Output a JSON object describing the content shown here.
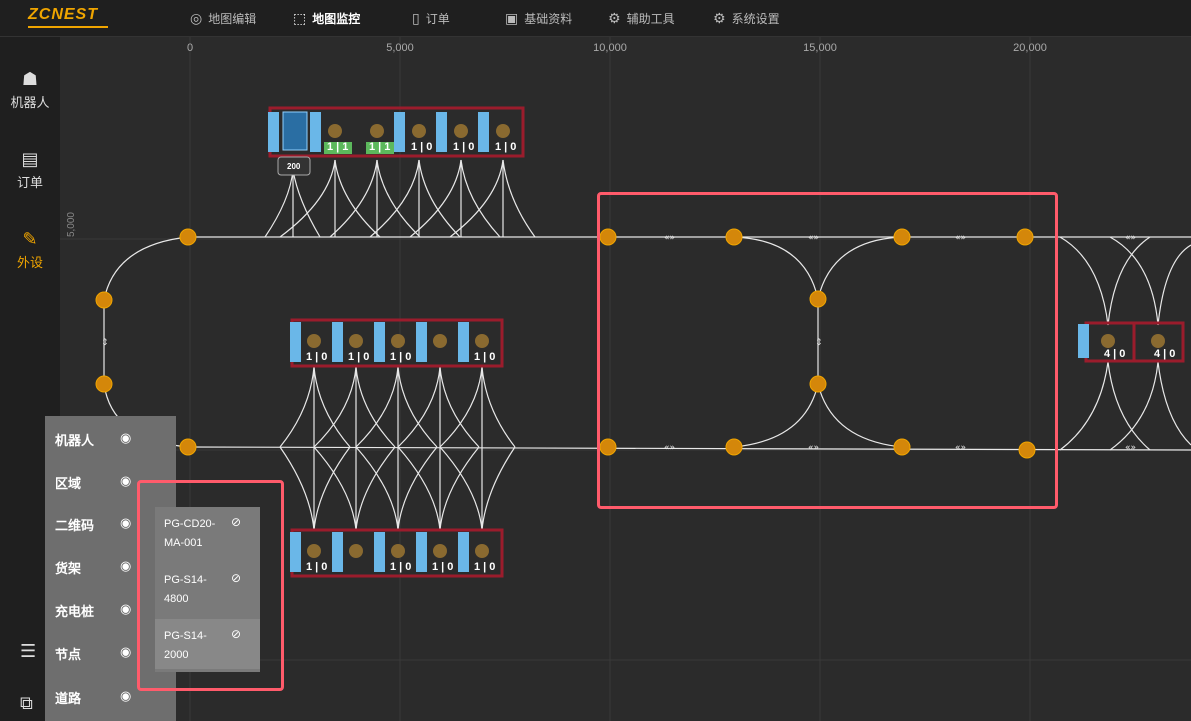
{
  "app": {
    "logo": "ZCNEST"
  },
  "nav": [
    {
      "label": "地图编辑",
      "icon": "location-pin-icon",
      "glyph": "◎",
      "active": false
    },
    {
      "label": "地图监控",
      "icon": "monitor-chart-icon",
      "glyph": "⬚",
      "active": true
    },
    {
      "label": "订单",
      "icon": "order-document-icon",
      "glyph": "▯",
      "active": false
    },
    {
      "label": "基础资料",
      "icon": "basic-data-icon",
      "glyph": "▣",
      "active": false
    },
    {
      "label": "辅助工具",
      "icon": "gear-icon",
      "glyph": "⚙",
      "active": false
    },
    {
      "label": "系统设置",
      "icon": "settings-icon",
      "glyph": "⚙",
      "active": false
    }
  ],
  "sidebar": [
    {
      "label": "机器人",
      "icon": "robot-icon",
      "glyph": "☗",
      "active": false
    },
    {
      "label": "订单",
      "icon": "document-icon",
      "glyph": "▤",
      "active": false
    },
    {
      "label": "外设",
      "icon": "wrench-icon",
      "glyph": "✎",
      "active": true
    }
  ],
  "ruler": {
    "x_ticks": [
      "0",
      "5,000",
      "10,000",
      "15,000",
      "20,000"
    ],
    "y_tick": "5,000"
  },
  "layers": [
    {
      "label": "机器人"
    },
    {
      "label": "区域"
    },
    {
      "label": "二维码"
    },
    {
      "label": "货架"
    },
    {
      "label": "充电桩"
    },
    {
      "label": "节点"
    },
    {
      "label": "道路"
    }
  ],
  "qr_list": [
    {
      "label": "PG-CD20-\nMA-001",
      "line1": "PG-CD20-",
      "line2": "MA-001"
    },
    {
      "label": "PG-S14-\n4800",
      "line1": "PG-S14-",
      "line2": "4800"
    },
    {
      "label": "PG-S14-\n2000",
      "line1": "PG-S14-",
      "line2": "2000"
    }
  ],
  "shelves": {
    "top_counts": [
      "1 | 1",
      "1 | 1",
      "1 | 0",
      "1 | 0",
      "1 | 0"
    ],
    "mid_counts": [
      "1 | 0",
      "1 | 0",
      "1 | 0",
      "1 | 0"
    ],
    "bottom_counts": [
      "1 | 0",
      "1 | 0",
      "1 | 0",
      "1 | 0"
    ],
    "right_counts": [
      "4 | 0",
      "4 | 0"
    ]
  },
  "robot": {
    "label": "200"
  },
  "colors": {
    "accent": "#f0a500",
    "node": "#d4870a",
    "shelf_border": "#9b1c2c",
    "highlight": "#ff5b6b",
    "charger_fill": "#5cb85c",
    "shelf_blue": "#6ab7e8"
  }
}
